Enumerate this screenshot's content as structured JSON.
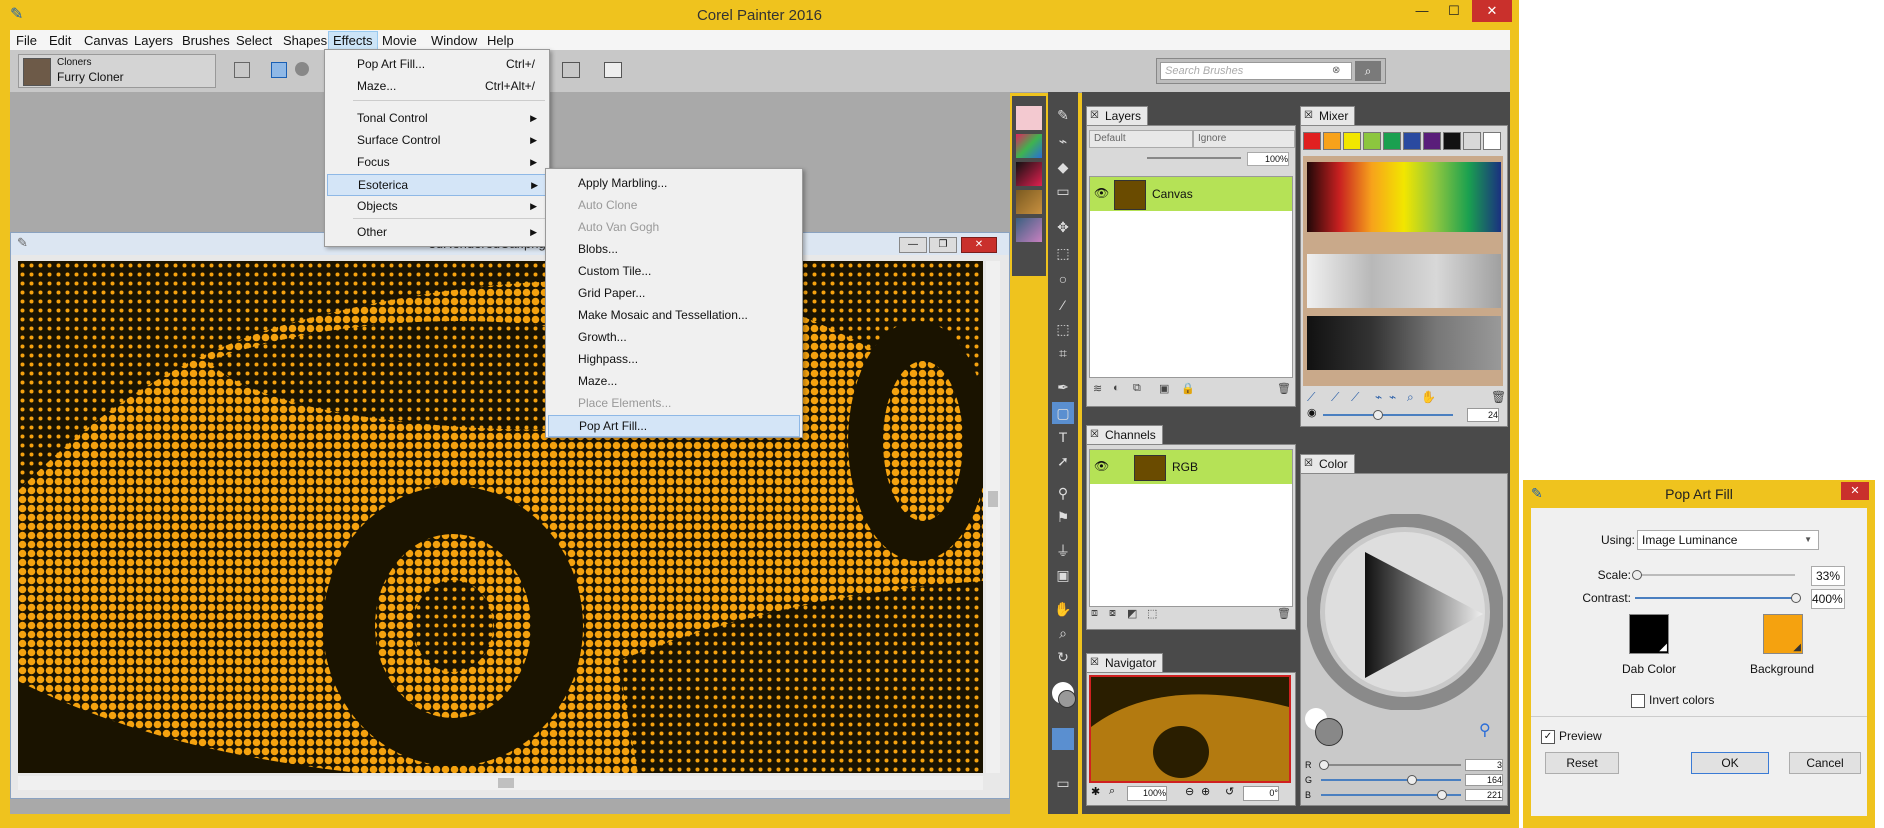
{
  "app": {
    "title": "Corel Painter 2016"
  },
  "menubar": [
    "File",
    "Edit",
    "Canvas",
    "Layers",
    "Brushes",
    "Select",
    "Shapes",
    "Effects",
    "Movie",
    "Window",
    "Help"
  ],
  "property_bar": {
    "category": "Cloners",
    "variant": "Furry Cloner",
    "search_placeholder": "Search Brushes"
  },
  "document": {
    "title": "3dRenderedCar.png @ 10..."
  },
  "effects_menu": [
    {
      "label": "Pop Art Fill...",
      "shortcut": "Ctrl+/"
    },
    {
      "label": "Maze...",
      "shortcut": "Ctrl+Alt+/"
    },
    {
      "label": "Tonal Control",
      "submenu": true
    },
    {
      "label": "Surface Control",
      "submenu": true
    },
    {
      "label": "Focus",
      "submenu": true
    },
    {
      "label": "Esoterica",
      "submenu": true,
      "highlighted": true
    },
    {
      "label": "Objects",
      "submenu": true
    },
    {
      "label": "Other",
      "submenu": true
    }
  ],
  "esoterica_menu": [
    {
      "label": "Apply Marbling...",
      "disabled": false
    },
    {
      "label": "Auto Clone",
      "disabled": true
    },
    {
      "label": "Auto Van Gogh",
      "disabled": true
    },
    {
      "label": "Blobs...",
      "disabled": false
    },
    {
      "label": "Custom Tile...",
      "disabled": false
    },
    {
      "label": "Grid Paper...",
      "disabled": false
    },
    {
      "label": "Make Mosaic and Tessellation...",
      "disabled": false
    },
    {
      "label": "Growth...",
      "disabled": false
    },
    {
      "label": "Highpass...",
      "disabled": false
    },
    {
      "label": "Maze...",
      "disabled": false
    },
    {
      "label": "Place Elements...",
      "disabled": true
    },
    {
      "label": "Pop Art Fill...",
      "disabled": false,
      "highlighted": true
    }
  ],
  "layers_panel": {
    "tab": "Layers",
    "composite": "Default",
    "depth": "Ignore",
    "opacity": "100%",
    "layer": "Canvas"
  },
  "channels_panel": {
    "tab": "Channels",
    "channel": "RGB"
  },
  "navigator_panel": {
    "tab": "Navigator",
    "zoom": "100%",
    "rotation": "0°"
  },
  "mixer_panel": {
    "tab": "Mixer",
    "brush_size": "24",
    "swatches": [
      "#e02020",
      "#f7a21b",
      "#f2e600",
      "#8cc63f",
      "#1aa050",
      "#2a4aa0",
      "#5a1e7a",
      "#111111",
      "#d8d8d8",
      "#ffffff"
    ]
  },
  "color_panel": {
    "tab": "Color",
    "r": "3",
    "g": "164",
    "b": "221",
    "r_label": "R",
    "g_label": "G",
    "b_label": "B"
  },
  "dialog": {
    "title": "Pop Art Fill",
    "using_label": "Using:",
    "using_value": "Image Luminance",
    "scale_label": "Scale:",
    "scale_value": "33%",
    "contrast_label": "Contrast:",
    "contrast_value": "400%",
    "dab_color_label": "Dab Color",
    "background_label": "Background",
    "dab_color": "#000000",
    "background_color": "#f5a20f",
    "invert_label": "Invert colors",
    "invert_checked": false,
    "preview_label": "Preview",
    "preview_checked": true,
    "reset_label": "Reset",
    "ok_label": "OK",
    "cancel_label": "Cancel"
  }
}
